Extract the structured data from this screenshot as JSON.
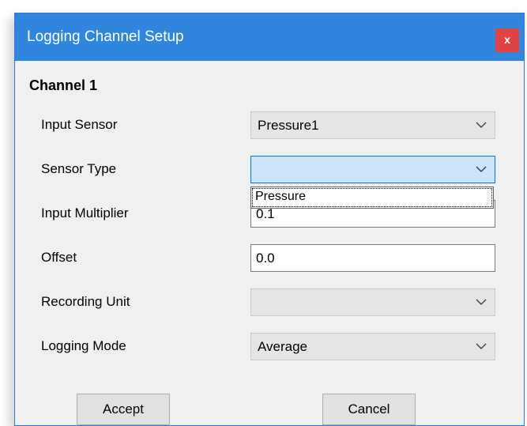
{
  "window": {
    "title": "Logging Channel Setup",
    "close_label": "x"
  },
  "group": {
    "title": "Channel 1"
  },
  "fields": {
    "input_sensor": {
      "label": "Input Sensor",
      "value": "Pressure1"
    },
    "sensor_type": {
      "label": "Sensor Type",
      "value": ""
    },
    "input_multiplier": {
      "label": "Input Multiplier",
      "value": "0.1"
    },
    "offset": {
      "label": "Offset",
      "value": "0.0"
    },
    "recording_unit": {
      "label": "Recording Unit",
      "value": ""
    },
    "logging_mode": {
      "label": "Logging Mode",
      "value": "Average"
    }
  },
  "sensor_type_dropdown": {
    "options": [
      "Pressure"
    ]
  },
  "buttons": {
    "accept": "Accept",
    "cancel": "Cancel"
  },
  "colors": {
    "titlebar": "#2f86dc",
    "close": "#e04343",
    "focus_border": "#0078d7",
    "focus_fill": "#cce4f7"
  }
}
